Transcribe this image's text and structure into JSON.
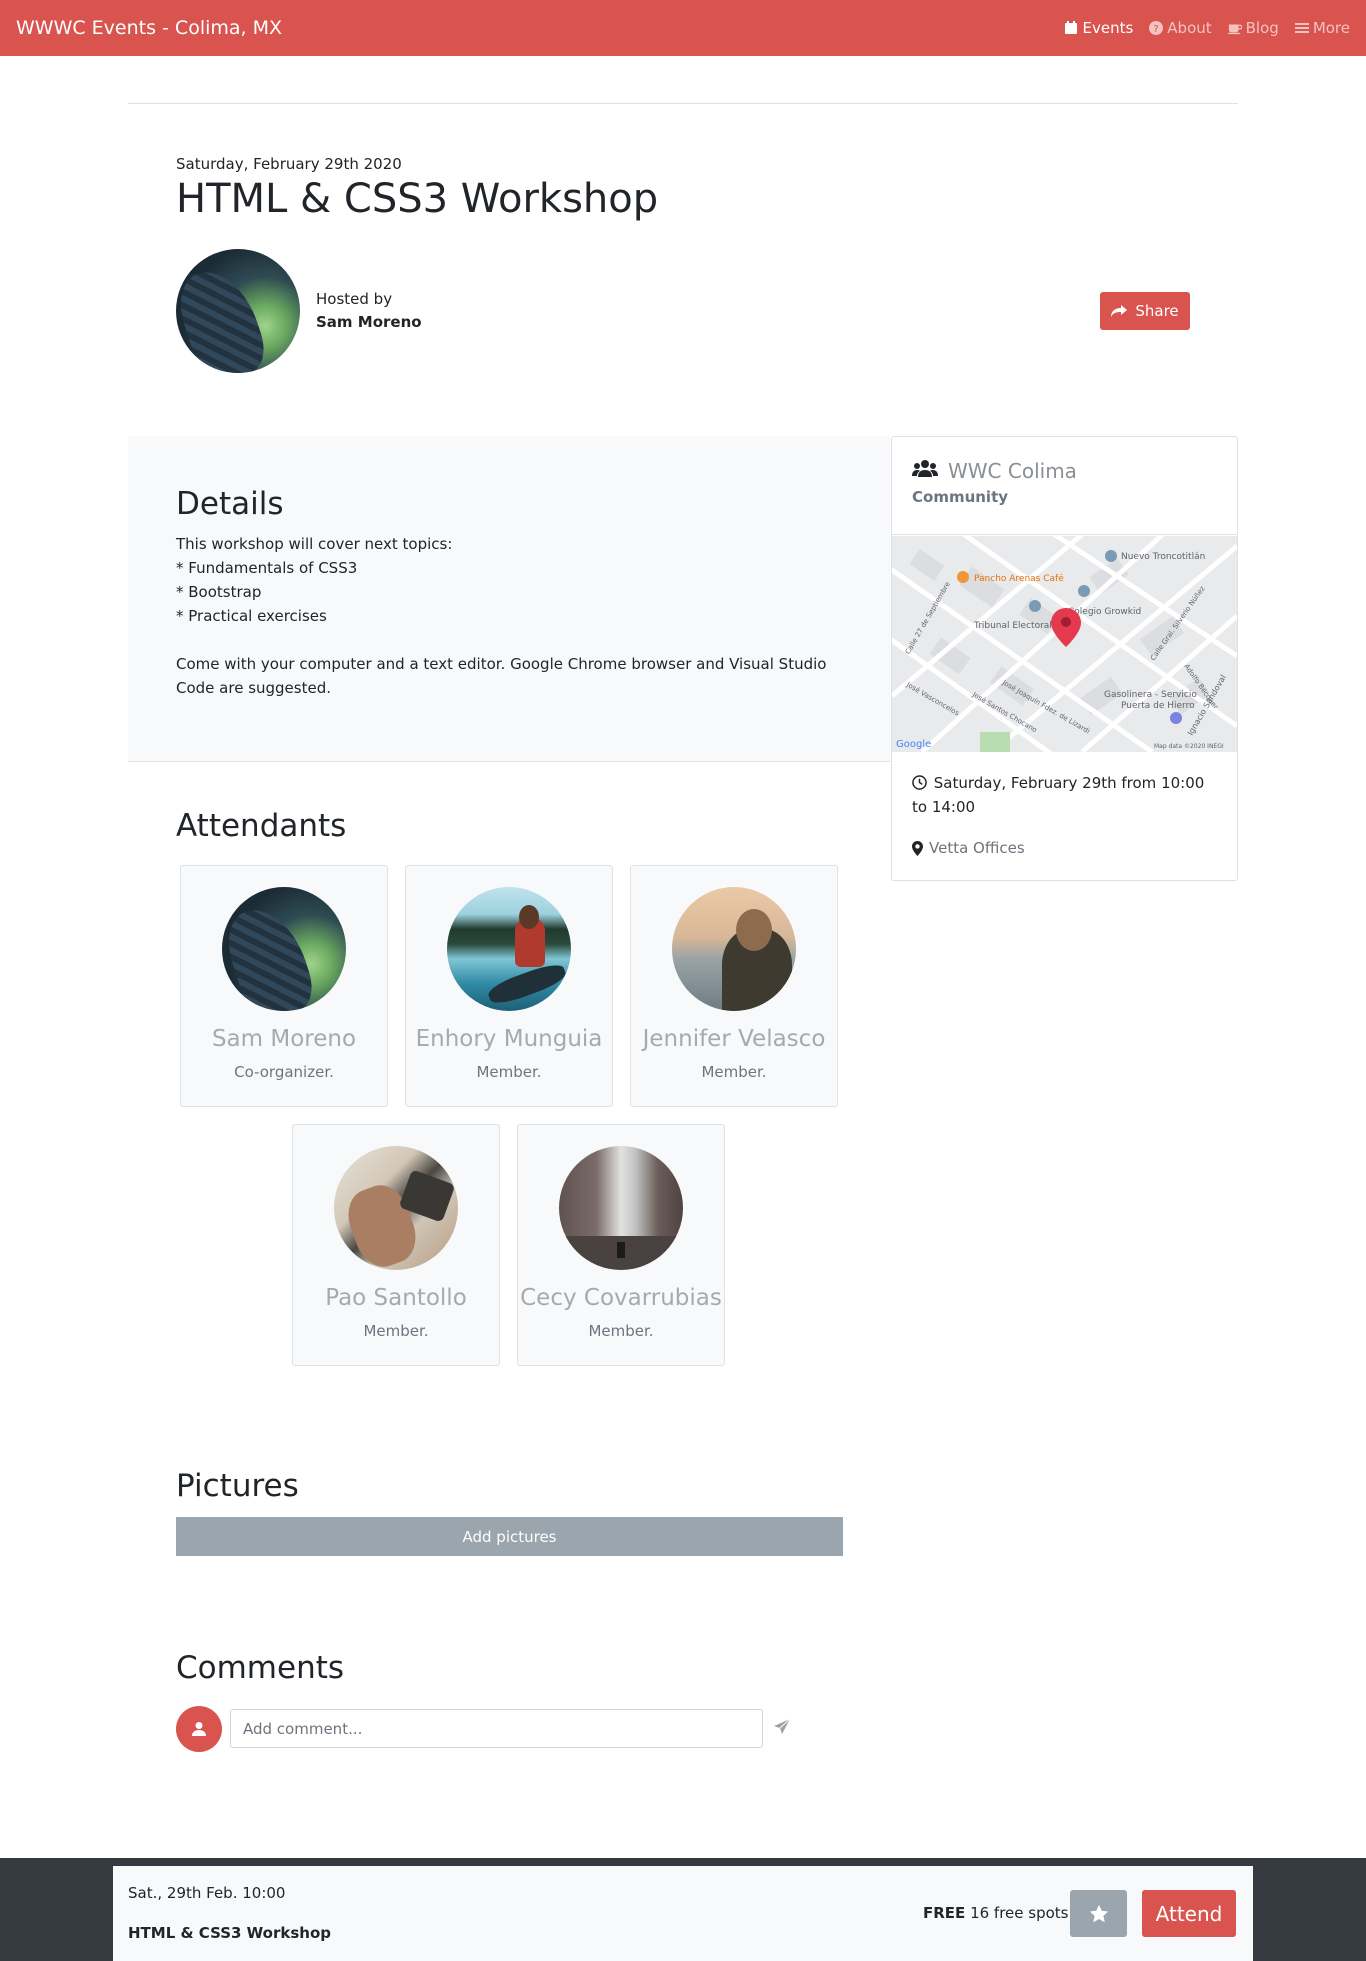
{
  "navbar": {
    "brand": "WWWC Events - Colima, MX",
    "links": [
      {
        "label": "Events",
        "icon": "calendar-icon",
        "active": true
      },
      {
        "label": "About",
        "icon": "question-circle-icon",
        "active": false
      },
      {
        "label": "Blog",
        "icon": "coffee-icon",
        "active": false
      },
      {
        "label": "More",
        "icon": "bars-icon",
        "active": false
      }
    ]
  },
  "event": {
    "date": "Saturday, February 29th 2020",
    "title": "HTML & CSS3 Workshop",
    "hosted_by_label": "Hosted by",
    "host_name": "Sam Moreno",
    "share_label": "Share"
  },
  "details": {
    "heading": "Details",
    "text": "This workshop will cover next topics:\n* Fundamentals of CSS3\n* Bootstrap\n* Practical exercises\n\nCome with your computer and a text editor. Google Chrome browser and Visual Studio Code are suggested."
  },
  "sidebar": {
    "community_name": "WWC Colima",
    "community_type": "Community",
    "map": {
      "labels": [
        "Nuevo Troncotitlán",
        "Pancho Arenas Café",
        "Colegio Growkid",
        "Tribunal Electoral",
        "Gasolinera - Servicio",
        "Puerta de Hierro",
        "Calle 27 de Septiembre",
        "José Joaquín Fdez. de Lizardi",
        "José Santos Chocano",
        "José Vasconcelos",
        "Calle Gral. Silverio Núñez",
        "Adolfo Bécquer",
        "Ignacio Sandoval"
      ],
      "google_label": "Google",
      "attribution": "Map data ©2020 INEGI"
    },
    "when": "Saturday, February 29th from 10:00 to 14:00",
    "where": "Vetta Offices"
  },
  "attendants": {
    "heading": "Attendants",
    "people": [
      {
        "name": "Sam Moreno",
        "role": "Co-organizer."
      },
      {
        "name": "Enhory Munguia",
        "role": "Member."
      },
      {
        "name": "Jennifer Velasco",
        "role": "Member."
      },
      {
        "name": "Pao Santollo",
        "role": "Member."
      },
      {
        "name": "Cecy Covarrubias",
        "role": "Member."
      }
    ]
  },
  "pictures": {
    "heading": "Pictures",
    "add_label": "Add pictures"
  },
  "comments": {
    "heading": "Comments",
    "placeholder": "Add comment..."
  },
  "footer": {
    "date": "Sat., 29th Feb. 10:00",
    "title": "HTML & CSS3 Workshop",
    "price": "FREE",
    "spots": "16 free spots",
    "attend_label": "Attend"
  },
  "colors": {
    "accent": "#d9534f",
    "secondary": "#9aa5ad",
    "dark": "#343a40",
    "light": "#f8f9fa"
  }
}
